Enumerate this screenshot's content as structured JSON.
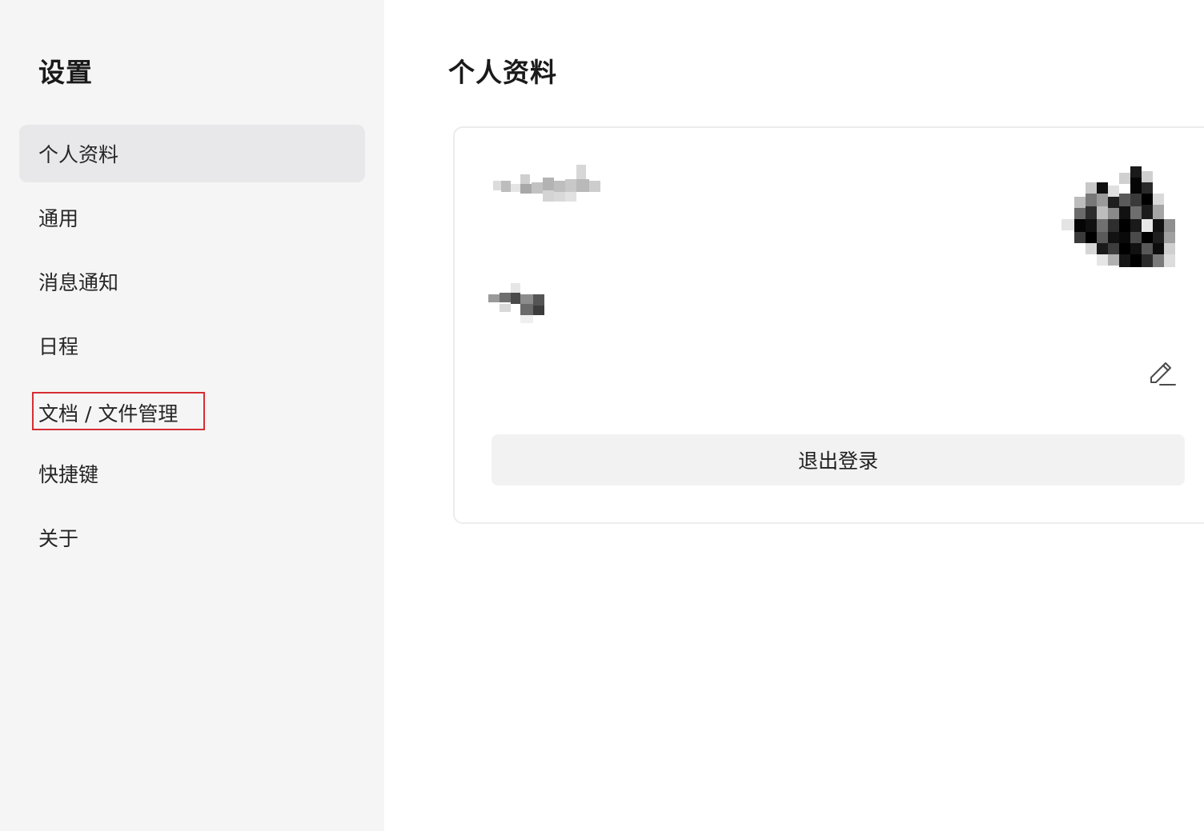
{
  "sidebar": {
    "title": "设置",
    "items": [
      {
        "label": "个人资料",
        "active": true
      },
      {
        "label": "通用",
        "active": false
      },
      {
        "label": "消息通知",
        "active": false
      },
      {
        "label": "日程",
        "active": false
      },
      {
        "label": "文档 / 文件管理",
        "active": false,
        "highlighted": true
      },
      {
        "label": "快捷键",
        "active": false
      },
      {
        "label": "关于",
        "active": false
      }
    ]
  },
  "main": {
    "title": "个人资料",
    "profile": {
      "name_obscured": true,
      "subtitle_obscured": true,
      "avatar_obscured": true,
      "edit_icon": "pencil-icon",
      "logout_label": "退出登录"
    }
  },
  "colors": {
    "sidebar_bg": "#f5f5f5",
    "active_item_bg": "#e8e8ea",
    "highlight_outline": "#d62d34",
    "logout_bg": "#f2f2f2",
    "card_border": "#ececec"
  }
}
